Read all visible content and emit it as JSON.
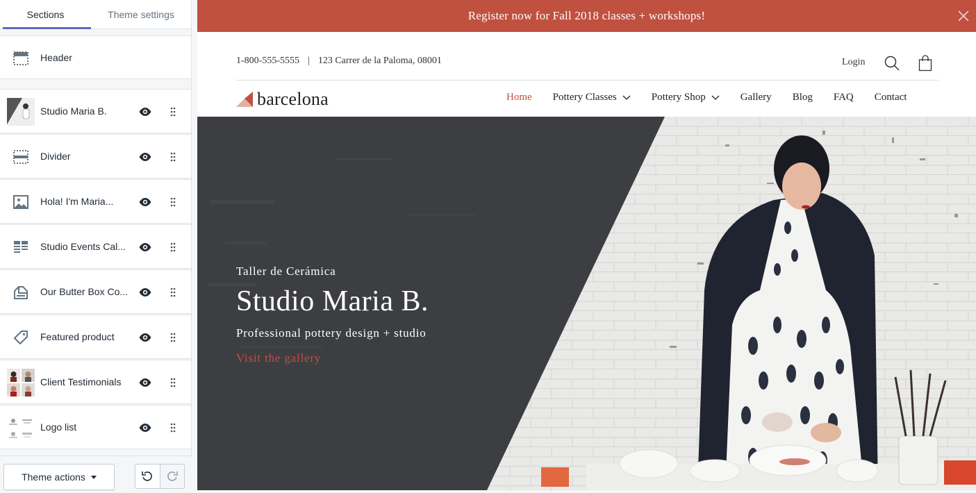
{
  "sidebar": {
    "tabs": [
      {
        "label": "Sections"
      },
      {
        "label": "Theme settings"
      }
    ],
    "header_item": {
      "label": "Header",
      "icon": "header-layout-icon"
    },
    "items": [
      {
        "label": "Studio Maria B.",
        "icon": "slideshow-thumbnail"
      },
      {
        "label": "Divider",
        "icon": "divider-icon"
      },
      {
        "label": "Hola! I'm Maria...",
        "icon": "image-icon"
      },
      {
        "label": "Studio Events Cal...",
        "icon": "list-grid-icon"
      },
      {
        "label": "Our Butter Box Co...",
        "icon": "collection-icon"
      },
      {
        "label": "Featured product",
        "icon": "tag-icon"
      },
      {
        "label": "Client Testimonials",
        "icon": "testimonial-thumbnails"
      },
      {
        "label": "Logo list",
        "icon": "logo-list-thumbnail"
      }
    ],
    "theme_actions_label": "Theme actions"
  },
  "preview": {
    "announcement": "Register now for Fall 2018 classes + workshops!",
    "phone": "1-800-555-5555",
    "separator": "|",
    "address": "123 Carrer de la Paloma, 08001",
    "login": "Login",
    "logo_text": "barcelona",
    "nav": [
      {
        "label": "Home",
        "active": true,
        "dropdown": false
      },
      {
        "label": "Pottery Classes",
        "active": false,
        "dropdown": true
      },
      {
        "label": "Pottery Shop",
        "active": false,
        "dropdown": true
      },
      {
        "label": "Gallery",
        "active": false,
        "dropdown": false
      },
      {
        "label": "Blog",
        "active": false,
        "dropdown": false
      },
      {
        "label": "FAQ",
        "active": false,
        "dropdown": false
      },
      {
        "label": "Contact",
        "active": false,
        "dropdown": false
      }
    ],
    "hero": {
      "subheading": "Taller de Cerámica",
      "title": "Studio Maria B.",
      "description": "Professional pottery design + studio",
      "link": "Visit the gallery"
    }
  },
  "colors": {
    "accent": "#c05040",
    "sidebar_tab_underline": "#5c6ac4",
    "hero_dark": "#3d3e42"
  }
}
